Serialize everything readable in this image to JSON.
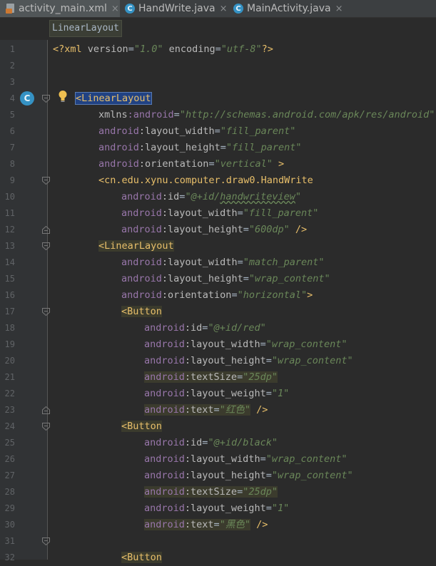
{
  "tabs": [
    {
      "label": "activity_main.xml",
      "icon": "xml-file-icon",
      "active": true
    },
    {
      "label": "HandWrite.java",
      "icon": "java-class-icon",
      "active": false
    },
    {
      "label": "MainActivity.java",
      "icon": "java-class-icon",
      "active": false
    }
  ],
  "tab_close_glyph": "×",
  "breadcrumb": "LinearLayout",
  "gutter_class_icon_letter": "C",
  "colors": {
    "background": "#2b2b2b",
    "gutter": "#313335",
    "tag": "#e8bf6a",
    "namespace": "#9876aa",
    "attribute": "#bababa",
    "value": "#6a8759",
    "selection": "#214283",
    "class_icon": "#3592c4"
  },
  "lines": [
    {
      "n": "1",
      "tokens": [
        {
          "t": "<?xml ",
          "c": "br"
        },
        {
          "t": "version",
          "c": "attr"
        },
        {
          "t": "=",
          "c": "plain"
        },
        {
          "t": "\"1.0\"",
          "c": "val"
        },
        {
          "t": " encoding",
          "c": "attr"
        },
        {
          "t": "=",
          "c": "plain"
        },
        {
          "t": "\"utf-8\"",
          "c": "val"
        },
        {
          "t": "?>",
          "c": "br"
        }
      ]
    },
    {
      "n": "2",
      "tokens": []
    },
    {
      "n": "3",
      "tokens": []
    },
    {
      "n": "4",
      "tokens": [
        {
          "t": "<LinearLayout",
          "c": "tag",
          "sel": true
        }
      ]
    },
    {
      "n": "5",
      "tokens": [
        {
          "t": "xmlns",
          "c": "attr"
        },
        {
          "t": ":android",
          "c": "ns"
        },
        {
          "t": "=",
          "c": "plain"
        },
        {
          "t": "\"http://schemas.android.com/apk/res/android\"",
          "c": "val"
        }
      ]
    },
    {
      "n": "6",
      "tokens": [
        {
          "t": "android",
          "c": "ns"
        },
        {
          "t": ":layout_width",
          "c": "attr"
        },
        {
          "t": "=",
          "c": "plain"
        },
        {
          "t": "\"fill_parent\"",
          "c": "val"
        }
      ]
    },
    {
      "n": "7",
      "tokens": [
        {
          "t": "android",
          "c": "ns"
        },
        {
          "t": ":layout_height",
          "c": "attr"
        },
        {
          "t": "=",
          "c": "plain"
        },
        {
          "t": "\"fill_parent\"",
          "c": "val"
        }
      ]
    },
    {
      "n": "8",
      "tokens": [
        {
          "t": "android",
          "c": "ns"
        },
        {
          "t": ":orientation",
          "c": "attr"
        },
        {
          "t": "=",
          "c": "plain"
        },
        {
          "t": "\"vertical\"",
          "c": "val"
        },
        {
          "t": " >",
          "c": "br"
        }
      ]
    },
    {
      "n": "9",
      "tokens": [
        {
          "t": "<cn.edu.xynu.computer.draw0.HandWrite",
          "c": "tag"
        }
      ]
    },
    {
      "n": "10",
      "tokens": [
        {
          "t": "android",
          "c": "ns"
        },
        {
          "t": ":id",
          "c": "attr"
        },
        {
          "t": "=",
          "c": "plain"
        },
        {
          "t": "\"@+id/",
          "c": "val"
        },
        {
          "t": "handwriteview",
          "c": "val",
          "sq": true
        },
        {
          "t": "\"",
          "c": "val"
        }
      ]
    },
    {
      "n": "11",
      "tokens": [
        {
          "t": "android",
          "c": "ns"
        },
        {
          "t": ":layout_width",
          "c": "attr"
        },
        {
          "t": "=",
          "c": "plain"
        },
        {
          "t": "\"fill_parent\"",
          "c": "val"
        }
      ]
    },
    {
      "n": "12",
      "tokens": [
        {
          "t": "android",
          "c": "ns"
        },
        {
          "t": ":layout_height",
          "c": "attr"
        },
        {
          "t": "=",
          "c": "plain"
        },
        {
          "t": "\"600dp\"",
          "c": "val"
        },
        {
          "t": " />",
          "c": "br"
        }
      ]
    },
    {
      "n": "13",
      "tokens": [
        {
          "t": "<LinearLayout",
          "c": "tag",
          "hl": true
        }
      ]
    },
    {
      "n": "14",
      "tokens": [
        {
          "t": "android",
          "c": "ns"
        },
        {
          "t": ":layout_width",
          "c": "attr"
        },
        {
          "t": "=",
          "c": "plain"
        },
        {
          "t": "\"match_parent\"",
          "c": "val"
        }
      ]
    },
    {
      "n": "15",
      "tokens": [
        {
          "t": "android",
          "c": "ns"
        },
        {
          "t": ":layout_height",
          "c": "attr"
        },
        {
          "t": "=",
          "c": "plain"
        },
        {
          "t": "\"wrap_content\"",
          "c": "val"
        }
      ]
    },
    {
      "n": "16",
      "tokens": [
        {
          "t": "android",
          "c": "ns"
        },
        {
          "t": ":orientation",
          "c": "attr"
        },
        {
          "t": "=",
          "c": "plain"
        },
        {
          "t": "\"horizontal\"",
          "c": "val"
        },
        {
          "t": ">",
          "c": "br"
        }
      ]
    },
    {
      "n": "17",
      "tokens": [
        {
          "t": "<Button",
          "c": "tag",
          "hl": true
        }
      ]
    },
    {
      "n": "18",
      "tokens": [
        {
          "t": "android",
          "c": "ns"
        },
        {
          "t": ":id",
          "c": "attr"
        },
        {
          "t": "=",
          "c": "plain"
        },
        {
          "t": "\"@+id/red\"",
          "c": "val"
        }
      ]
    },
    {
      "n": "19",
      "tokens": [
        {
          "t": "android",
          "c": "ns"
        },
        {
          "t": ":layout_width",
          "c": "attr"
        },
        {
          "t": "=",
          "c": "plain"
        },
        {
          "t": "\"wrap_content\"",
          "c": "val"
        }
      ]
    },
    {
      "n": "20",
      "tokens": [
        {
          "t": "android",
          "c": "ns"
        },
        {
          "t": ":layout_height",
          "c": "attr"
        },
        {
          "t": "=",
          "c": "plain"
        },
        {
          "t": "\"wrap_content\"",
          "c": "val"
        }
      ]
    },
    {
      "n": "21",
      "tokens": [
        {
          "t": "android",
          "c": "ns",
          "hl": true
        },
        {
          "t": ":textSize",
          "c": "attr",
          "hl": true
        },
        {
          "t": "=",
          "c": "plain",
          "hl": true
        },
        {
          "t": "\"25dp\"",
          "c": "val",
          "hl": true
        }
      ]
    },
    {
      "n": "22",
      "tokens": [
        {
          "t": "android",
          "c": "ns"
        },
        {
          "t": ":layout_weight",
          "c": "attr"
        },
        {
          "t": "=",
          "c": "plain"
        },
        {
          "t": "\"1\"",
          "c": "val"
        }
      ]
    },
    {
      "n": "23",
      "tokens": [
        {
          "t": "android",
          "c": "ns",
          "hl": true
        },
        {
          "t": ":text",
          "c": "attr",
          "hl": true
        },
        {
          "t": "=",
          "c": "plain",
          "hl": true
        },
        {
          "t": "\"红色\"",
          "c": "val",
          "hl": true
        },
        {
          "t": " />",
          "c": "br"
        }
      ]
    },
    {
      "n": "24",
      "tokens": [
        {
          "t": "<Button",
          "c": "tag",
          "hl": true
        }
      ]
    },
    {
      "n": "25",
      "tokens": [
        {
          "t": "android",
          "c": "ns"
        },
        {
          "t": ":id",
          "c": "attr"
        },
        {
          "t": "=",
          "c": "plain"
        },
        {
          "t": "\"@+id/black\"",
          "c": "val"
        }
      ]
    },
    {
      "n": "26",
      "tokens": [
        {
          "t": "android",
          "c": "ns"
        },
        {
          "t": ":layout_width",
          "c": "attr"
        },
        {
          "t": "=",
          "c": "plain"
        },
        {
          "t": "\"wrap_content\"",
          "c": "val"
        }
      ]
    },
    {
      "n": "27",
      "tokens": [
        {
          "t": "android",
          "c": "ns"
        },
        {
          "t": ":layout_height",
          "c": "attr"
        },
        {
          "t": "=",
          "c": "plain"
        },
        {
          "t": "\"wrap_content\"",
          "c": "val"
        }
      ]
    },
    {
      "n": "28",
      "tokens": [
        {
          "t": "android",
          "c": "ns",
          "hl": true
        },
        {
          "t": ":textSize",
          "c": "attr",
          "hl": true
        },
        {
          "t": "=",
          "c": "plain",
          "hl": true
        },
        {
          "t": "\"25dp\"",
          "c": "val",
          "hl": true
        }
      ]
    },
    {
      "n": "29",
      "tokens": [
        {
          "t": "android",
          "c": "ns"
        },
        {
          "t": ":layout_weight",
          "c": "attr"
        },
        {
          "t": "=",
          "c": "plain"
        },
        {
          "t": "\"1\"",
          "c": "val"
        }
      ]
    },
    {
      "n": "30",
      "tokens": [
        {
          "t": "android",
          "c": "ns",
          "hl": true
        },
        {
          "t": ":text",
          "c": "attr",
          "hl": true
        },
        {
          "t": "=",
          "c": "plain",
          "hl": true
        },
        {
          "t": "\"黑色\"",
          "c": "val",
          "hl": true
        },
        {
          "t": " />",
          "c": "br"
        }
      ]
    },
    {
      "n": "31",
      "tokens": []
    },
    {
      "n": "32",
      "tokens": [
        {
          "t": "<Button",
          "c": "tag",
          "hl": true
        }
      ]
    }
  ]
}
